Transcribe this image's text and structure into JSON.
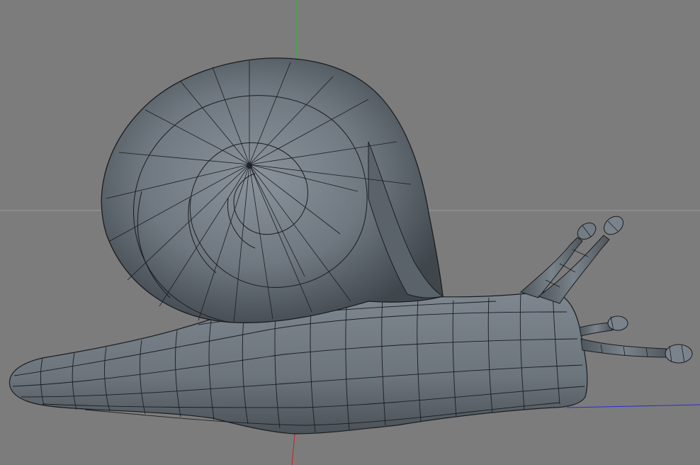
{
  "viewport": {
    "background_color": "#7c7c7c",
    "grid_color": "#9a9a9a",
    "model_color": "#6e7780",
    "model_edge_color": "#1a1d20",
    "axis_colors": {
      "y": "#1ec21e",
      "x": "#d01c1c",
      "z": "#2b2bd8"
    }
  },
  "scene": {
    "object": "snail-mesh",
    "parts": [
      "shell",
      "body",
      "eye-stalks",
      "lower-tentacles"
    ]
  }
}
